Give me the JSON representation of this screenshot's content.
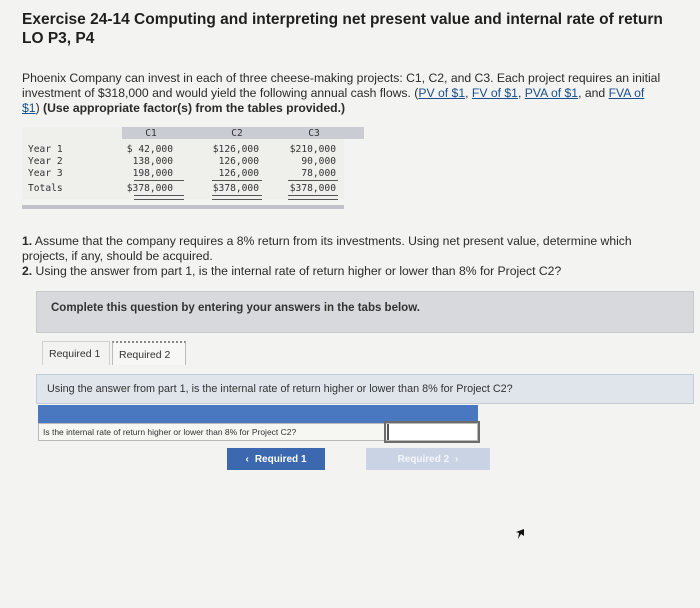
{
  "header": {
    "title_line1": "Exercise 24-14 Computing and interpreting net present value and internal rate of return",
    "title_line2": "LO P3, P4"
  },
  "intro": {
    "text": "Phoenix Company can invest in each of three cheese-making projects: C1, C2, and C3. Each project requires an initial investment of $318,000 and would yield the following annual cash flows. ",
    "link_pv": "PV of $1",
    "link_fv": "FV of $1",
    "link_pva": "PVA of $1",
    "link_fva": "FVA of $1",
    "sep_open": "(",
    "sep_comma": ", ",
    "sep_and": ", and ",
    "sep_close": ")",
    "instruction": "(Use appropriate factor(s) from the tables provided.)"
  },
  "cash_flows": {
    "columns": [
      "C1",
      "C2",
      "C3"
    ],
    "rows": [
      {
        "label": "Year 1",
        "values": [
          "$ 42,000",
          "$126,000",
          "$210,000"
        ]
      },
      {
        "label": "Year 2",
        "values": [
          "138,000",
          "126,000",
          "90,000"
        ]
      },
      {
        "label": "Year 3",
        "values": [
          "198,000",
          "126,000",
          "78,000"
        ]
      },
      {
        "label": "Totals",
        "values": [
          "$378,000",
          "$378,000",
          "$378,000"
        ]
      }
    ]
  },
  "questions": {
    "q1_num": "1.",
    "q1_text": " Assume that the company requires a 8% return from its investments. Using net present value, determine which projects, if any, should be acquired.",
    "q2_num": "2.",
    "q2_text": " Using the answer from part 1, is the internal rate of return higher or lower than 8% for Project C2?"
  },
  "complete_banner": "Complete this question by entering your answers in the tabs below.",
  "tabs": [
    {
      "label": "Required 1"
    },
    {
      "label": "Required 2"
    }
  ],
  "tab_question": "Using the answer from part 1, is the internal rate of return higher or lower than 8% for Project C2?",
  "answer": {
    "label": "Is the internal rate of return higher or lower than 8% for Project C2?",
    "value": ""
  },
  "nav": {
    "prev_label": "Required 1",
    "next_label": "Required 2",
    "prev_icon": "chevron-left-icon",
    "next_icon": "chevron-right-icon"
  },
  "colors": {
    "primary_button": "#3c68b0",
    "disabled_button": "#c9d3e3",
    "answer_header": "#4a78c0"
  }
}
